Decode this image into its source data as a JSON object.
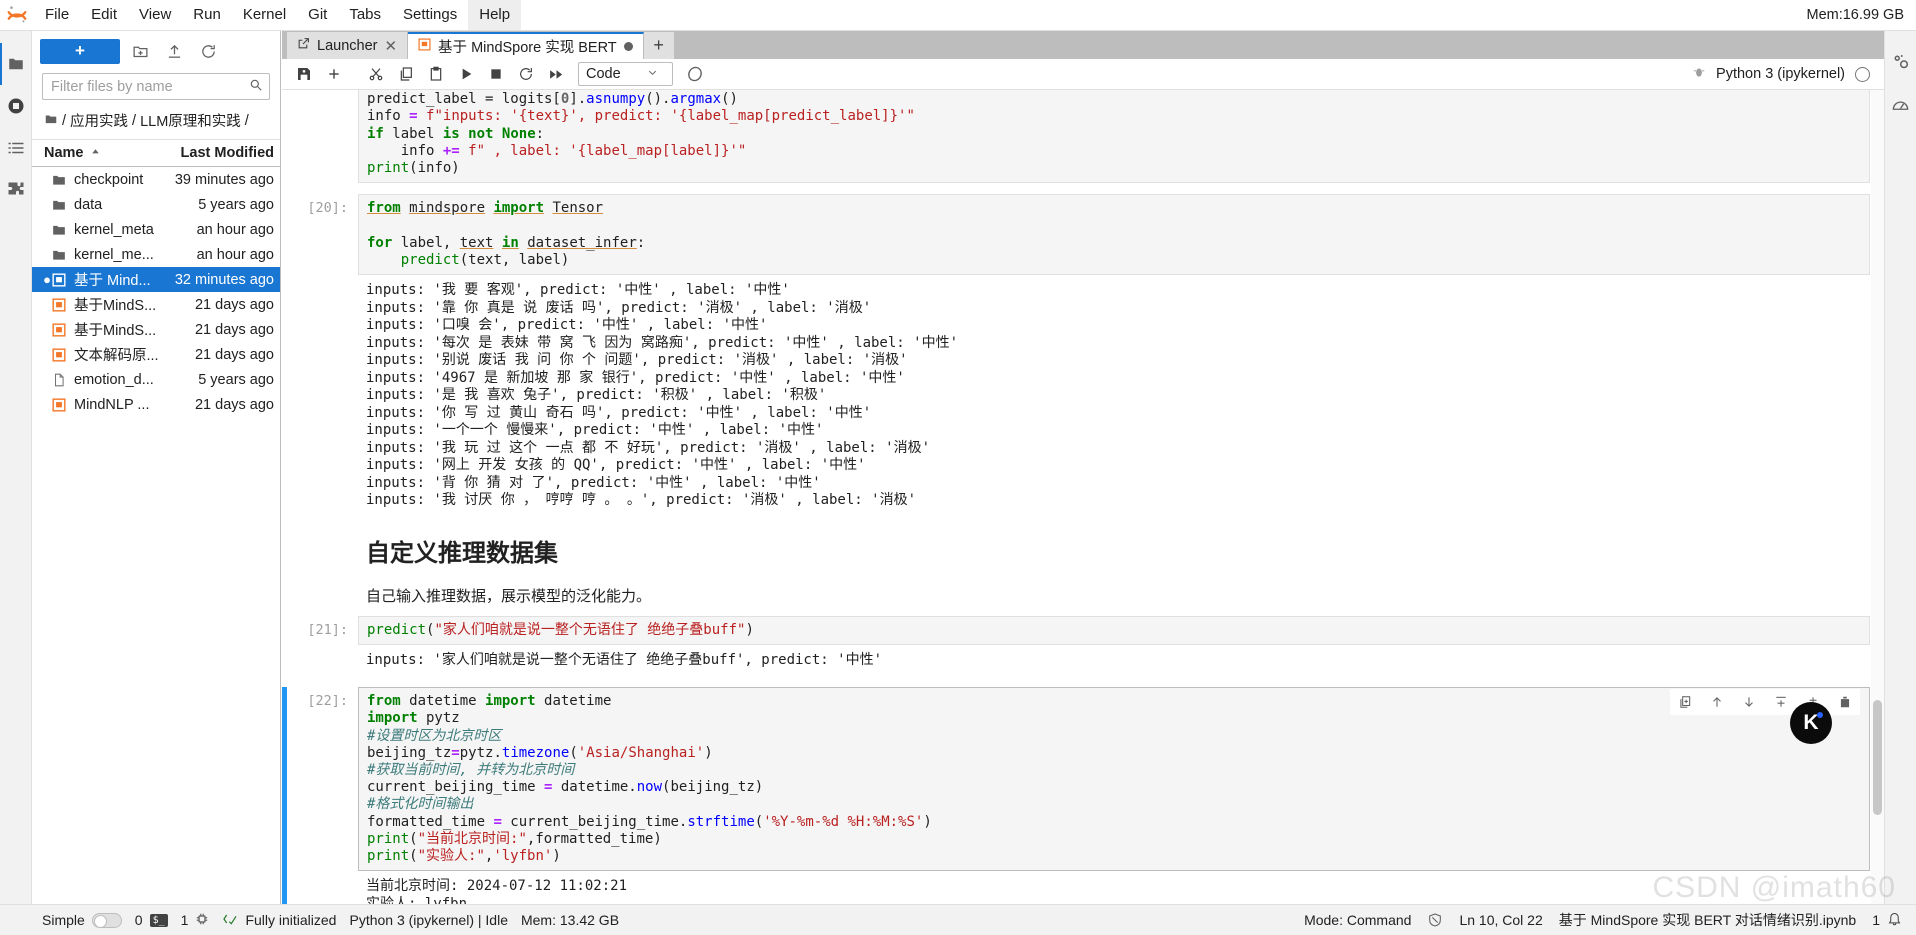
{
  "window": {
    "memory_indicator": "Mem:16.99 GB"
  },
  "menubar": {
    "logo_name": "jupyter-logo",
    "items": [
      {
        "label": "File"
      },
      {
        "label": "Edit"
      },
      {
        "label": "View"
      },
      {
        "label": "Run"
      },
      {
        "label": "Kernel"
      },
      {
        "label": "Git"
      },
      {
        "label": "Tabs"
      },
      {
        "label": "Settings"
      },
      {
        "label": "Help"
      }
    ],
    "active_item": "Help"
  },
  "left_rail": {
    "icons": [
      "folder-icon",
      "running-terminals-icon",
      "table-of-contents-icon",
      "extensions-icon"
    ]
  },
  "right_rail": {
    "icons": [
      "property-inspector-icon",
      "debugger-icon"
    ]
  },
  "filebrowser": {
    "new_launcher_label": "+",
    "toolbar_icons": [
      "new-folder-icon",
      "upload-icon",
      "refresh-icon"
    ],
    "filter": {
      "placeholder": "Filter files by name",
      "value": "",
      "icon": "search-icon"
    },
    "breadcrumb": [
      "/",
      "应用实践",
      "/",
      "LLM原理和实践",
      "/"
    ],
    "columns": {
      "name": "Name",
      "last_modified": "Last Modified",
      "sort_indicator": "caret-up-icon"
    },
    "rows": [
      {
        "name": "checkpoint",
        "modified": "39 minutes ago",
        "type": "folder",
        "selected": false,
        "dirty": false
      },
      {
        "name": "data",
        "modified": "5 years ago",
        "type": "folder",
        "selected": false,
        "dirty": false
      },
      {
        "name": "kernel_meta",
        "modified": "an hour ago",
        "type": "folder",
        "selected": false,
        "dirty": false
      },
      {
        "name": "kernel_me...",
        "modified": "an hour ago",
        "type": "folder",
        "selected": false,
        "dirty": false
      },
      {
        "name": "基于 Mind...",
        "modified": "32 minutes ago",
        "type": "notebook",
        "selected": true,
        "dirty": true
      },
      {
        "name": "基于MindS...",
        "modified": "21 days ago",
        "type": "notebook",
        "selected": false,
        "dirty": false
      },
      {
        "name": "基于MindS...",
        "modified": "21 days ago",
        "type": "notebook",
        "selected": false,
        "dirty": false
      },
      {
        "name": "文本解码原...",
        "modified": "21 days ago",
        "type": "notebook",
        "selected": false,
        "dirty": false
      },
      {
        "name": "emotion_d...",
        "modified": "5 years ago",
        "type": "file",
        "selected": false,
        "dirty": false
      },
      {
        "name": "MindNLP ...",
        "modified": "21 days ago",
        "type": "notebook",
        "selected": false,
        "dirty": false
      }
    ]
  },
  "dock": {
    "tabs": [
      {
        "label": "Launcher",
        "icon": "launcher-icon",
        "current": false,
        "closable": true
      },
      {
        "label": "基于 MindSpore 实现 BERT",
        "icon": "notebook-icon",
        "current": true,
        "dirty": true
      }
    ],
    "add_tab_label": "+"
  },
  "notebook_toolbar": {
    "buttons": [
      {
        "name": "save-button",
        "icon": "save-icon"
      },
      {
        "name": "insert-cell-button",
        "icon": "plus-icon"
      },
      {
        "name": "cut-cell-button",
        "icon": "scissors-icon"
      },
      {
        "name": "copy-cell-button",
        "icon": "copy-icon"
      },
      {
        "name": "paste-cell-button",
        "icon": "paste-icon"
      },
      {
        "name": "run-cell-button",
        "icon": "play-icon"
      },
      {
        "name": "interrupt-kernel-button",
        "icon": "stop-icon"
      },
      {
        "name": "restart-kernel-button",
        "icon": "restart-icon"
      },
      {
        "name": "restart-run-all-button",
        "icon": "fast-forward-icon"
      }
    ],
    "cell_type": "Code",
    "cell_type_caret": "chevron-down-icon",
    "mindspore_icon": "mindspore-logo-icon",
    "kernel_bug_icon": "debug-icon",
    "kernel_name": "Python 3 (ipykernel)",
    "kernel_status": "idle-circle-icon"
  },
  "notebook": {
    "cells": [
      {
        "id": "cell-partial-code",
        "type": "code",
        "prompt": "",
        "source_lines": [
          "predict_label = logits[0].asnumpy().argmax()",
          "info = f\"inputs: '{text}', predict: '{label_map[predict_label]}'\"",
          "if label is not None:",
          "    info += f\" , label: '{label_map[label]}'\"",
          "print(info)"
        ],
        "outputs": []
      },
      {
        "id": "cell-20",
        "type": "code",
        "prompt": "[20]:",
        "source_lines": [
          "from mindspore import Tensor",
          "",
          "for label, text in dataset_infer:",
          "    predict(text, label)"
        ],
        "outputs": [
          "inputs: '我 要 客观', predict: '中性' , label: '中性'",
          "inputs: '靠 你 真是 说 废话 吗', predict: '消极' , label: '消极'",
          "inputs: '口嗅 会', predict: '中性' , label: '中性'",
          "inputs: '每次 是 表妹 带 窝 飞 因为 窝路痴', predict: '中性' , label: '中性'",
          "inputs: '别说 废话 我 问 你 个 问题', predict: '消极' , label: '消极'",
          "inputs: '4967 是 新加坡 那 家 银行', predict: '中性' , label: '中性'",
          "inputs: '是 我 喜欢 兔子', predict: '积极' , label: '积极'",
          "inputs: '你 写 过 黄山 奇石 吗', predict: '中性' , label: '中性'",
          "inputs: '一个一个 慢慢来', predict: '中性' , label: '中性'",
          "inputs: '我 玩 过 这个 一点 都 不 好玩', predict: '消极' , label: '消极'",
          "inputs: '网上 开发 女孩 的 QQ', predict: '中性' , label: '中性'",
          "inputs: '背 你 猜 对 了', predict: '中性' , label: '中性'",
          "inputs: '我 讨厌 你 ， 哼哼 哼 。 。', predict: '消极' , label: '消极'"
        ]
      },
      {
        "id": "cell-markdown",
        "type": "markdown",
        "heading": "自定义推理数据集",
        "paragraph": "自己输入推理数据，展示模型的泛化能力。"
      },
      {
        "id": "cell-21",
        "type": "code",
        "prompt": "[21]:",
        "source_lines": [
          "predict(\"家人们咱就是说一整个无语住了 绝绝子叠buff\")"
        ],
        "outputs": [
          "inputs: '家人们咱就是说一整个无语住了 绝绝子叠buff', predict: '中性'"
        ]
      },
      {
        "id": "cell-22",
        "type": "code",
        "prompt": "[22]:",
        "selected": true,
        "source_lines": [
          "from datetime import datetime",
          "import pytz",
          "#设置时区为北京时区",
          "beijing_tz=pytz.timezone('Asia/Shanghai')",
          "#获取当前时间, 并转为北京时间",
          "current_beijing_time = datetime.now(beijing_tz)",
          "#格式化时间输出",
          "formatted_time = current_beijing_time.strftime('%Y-%m-%d %H:%M:%S')",
          "print(\"当前北京时间:\",formatted_time)",
          "print(\"实验人:\",'lyfbn')"
        ],
        "outputs": [
          "当前北京时间: 2024-07-12 11:02:21",
          "实验人: lyfbn"
        ],
        "toolbar_icons": [
          "duplicate-cell-icon",
          "move-cell-up-icon",
          "move-cell-down-icon",
          "insert-cell-above-icon",
          "insert-cell-below-icon",
          "delete-cell-icon"
        ]
      }
    ]
  },
  "floating_badge": {
    "label": "K",
    "name": "kernel-assistant-badge"
  },
  "statusbar": {
    "simple_label": "Simple",
    "terminal_count": "0",
    "terminal_icon": "terminal-icon",
    "kernel_count": "1",
    "kernel_icon": "cpu-icon",
    "init_icon": "code-check-icon",
    "init_text": "Fully initialized",
    "kernel_state": "Python 3 (ipykernel) | Idle",
    "memory": "Mem: 13.42 GB",
    "mode": "Mode: Command",
    "shield_icon": "no-trust-icon",
    "cursor_position": "Ln 10, Col 22",
    "filename": "基于 MindSpore 实现 BERT 对话情绪识别.ipynb",
    "notification_count": "1",
    "notification_icon": "bell-icon"
  },
  "watermark": "CSDN @imath60",
  "colors": {
    "accent": "#1976d2",
    "selected_cell_bar": "#2196f3",
    "string": "#ba2121",
    "keyword": "#008000",
    "comment": "#3D7B7B",
    "toolbar_bg": "#f5f5f5"
  }
}
